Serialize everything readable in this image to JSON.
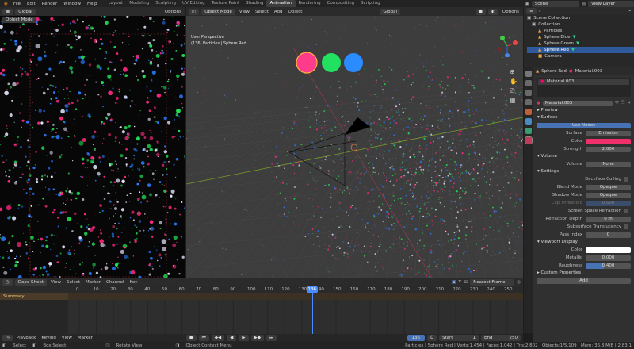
{
  "top_menu": [
    "File",
    "Edit",
    "Render",
    "Window",
    "Help"
  ],
  "workspaces": [
    "Layout",
    "Modeling",
    "Sculpting",
    "UV Editing",
    "Texture Paint",
    "Shading",
    "Animation",
    "Rendering",
    "Compositing",
    "Scripting"
  ],
  "active_workspace": "Animation",
  "scene": "Scene",
  "view_layer": "View Layer",
  "left_header": {
    "orientation": "Global",
    "mode": "Object Mode",
    "options": "Options"
  },
  "viewport": {
    "mode": "Object Mode",
    "menus": [
      "View",
      "Select",
      "Add",
      "Object"
    ],
    "orientation": "Global",
    "options": "Options",
    "title": "User Perspective",
    "subtitle": "(136) Particles | Sphere Red",
    "spheres": [
      {
        "color": "#ff3c8c"
      },
      {
        "color": "#22e060"
      },
      {
        "color": "#2a8cff"
      }
    ]
  },
  "outliner": {
    "items": [
      {
        "label": "Scene Collection",
        "sel": false,
        "color": "#bbbbbb"
      },
      {
        "label": "Collection",
        "sel": false,
        "color": "#bbbbbb"
      },
      {
        "label": "Particles",
        "sel": false,
        "color": "#e8a040"
      },
      {
        "label": "Sphere Blue",
        "sel": false,
        "color": "#e8a040"
      },
      {
        "label": "Sphere Green",
        "sel": false,
        "color": "#e8a040"
      },
      {
        "label": "Sphere Red",
        "sel": true,
        "color": "#e8a040"
      },
      {
        "label": "Camera",
        "sel": false,
        "color": "#e8a040"
      }
    ]
  },
  "properties": {
    "object": "Sphere Red",
    "material_slot": "Material.003",
    "slot_item": "Material.003",
    "material_name": "Material.003",
    "preview": "Preview",
    "surface": "Surface",
    "use_nodes": "Use Nodes",
    "surface_type_label": "Surface",
    "surface_type": "Emission",
    "color_label": "Color",
    "color_value": "#f0306a",
    "strength_label": "Strength",
    "strength": "2.000",
    "volume": "Volume",
    "volume_label": "Volume",
    "volume_value": "None",
    "settings": "Settings",
    "backface": "Backface Culling",
    "blend_label": "Blend Mode",
    "blend": "Opaque",
    "shadow_label": "Shadow Mode",
    "shadow": "Opaque",
    "clip_label": "Clip Threshold",
    "clip": "0.500",
    "ssr": "Screen Space Refraction",
    "refdepth_label": "Refraction Depth",
    "refdepth": "0 m",
    "sst": "Subsurface Translucency",
    "pass_label": "Pass Index",
    "pass": "0",
    "viewport_display": "Viewport Display",
    "vd_color_label": "Color",
    "vd_color": "#ffffff",
    "metallic_label": "Metallic",
    "metallic": "0.000",
    "roughness_label": "Roughness",
    "roughness": "0.400",
    "roughness_frac": 0.4,
    "custom": "Custom Properties",
    "add": "Add"
  },
  "timeline": {
    "editor": "Dope Sheet",
    "menus": [
      "View",
      "Select",
      "Marker",
      "Channel",
      "Key"
    ],
    "snap": "Nearest Frame",
    "summary": "Summary",
    "ticks": [
      "0",
      "10",
      "20",
      "30",
      "40",
      "50",
      "60",
      "70",
      "80",
      "90",
      "100",
      "110",
      "120",
      "130",
      "136",
      "140",
      "150",
      "160",
      "170",
      "180",
      "190",
      "200",
      "210",
      "220",
      "230",
      "240",
      "250"
    ],
    "current": "136",
    "current_frame": 136,
    "frame_end": 250,
    "start_label": "Start",
    "start": "1",
    "end_label": "End",
    "end": "250",
    "playback": "Playback",
    "keying": "Keying",
    "view": "View",
    "marker": "Marker"
  },
  "status": {
    "select": "Select",
    "box": "Box Select",
    "rotate": "Rotate View",
    "context": "Object Context Menu",
    "info": "Particles | Sphere Red | Verts:1,454 | Faces:1,042 | Tris:2,802 | Objects:1/5,109 | Mem: 36.8 MiB | 2.83.1"
  }
}
